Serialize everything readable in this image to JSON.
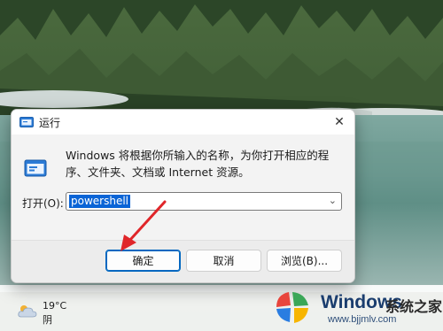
{
  "dialog": {
    "title": "运行",
    "close_glyph": "✕",
    "description": "Windows 将根据你所输入的名称，为你打开相应的程序、文件夹、文档或 Internet 资源。",
    "open_label": "打开(O):",
    "open_value": "powershell",
    "dropdown_glyph": "⌄",
    "buttons": {
      "ok": "确定",
      "cancel": "取消",
      "browse": "浏览(B)..."
    }
  },
  "weather": {
    "temperature": "19°C",
    "condition": "阴",
    "icon": "cloud-sun-icon"
  },
  "watermark": {
    "brand": "Windows",
    "cn": "系统之家",
    "url": "www.bjjmlv.com"
  },
  "colors": {
    "accent": "#0067c0",
    "selection": "#0a64d6",
    "arrow": "#e0262a"
  }
}
